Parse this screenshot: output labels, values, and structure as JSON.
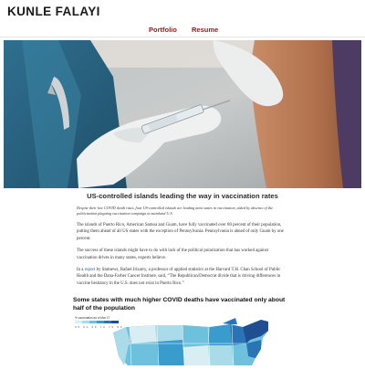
{
  "site": {
    "title": "KUNLE FALAYI",
    "nav": [
      "Portfolio",
      "Resume"
    ]
  },
  "article": {
    "headline": "US-controlled islands leading the way in vaccination rates",
    "dek": "Despite their low COVID death rates, four US-controlled islands are leading most states in vaccination, aided by absence of the politicization plaguing vaccination campaign in mainland U.S.",
    "para1": "The islands of Puerto Rico, American Samoa and Guam, have fully vaccinated over 80 percent of their population, putting them ahead of all US states with the exception of Pennsylvania. Pennsylvania is ahead of only Guam by one percent.",
    "para2": "The success of these islands might have to do with lack of the political polarization that has worked against vaccination drives in many states, experts believe.",
    "para3_before": "In a ",
    "para3_link": "report",
    "para3_after": " by Statnews, Rafael Irizarry, a professor of applied statistics at the Harvard T.H. Chan School of Public Health and the Dana-Farber Cancer Institute, said, “The Republican/Democrat divide that is driving differences in vaccine hesitancy in the U.S. does not exist in Puerto Rico.”",
    "section_heading": "Some states with much higher COVID deaths have vaccinated only about half of the population"
  },
  "map_legend": {
    "title": "% vaccination as of Mar 17",
    "ticks": "55 60 65 70 75 80",
    "colors": [
      "#d8eef3",
      "#a9dbe8",
      "#6ec1dd",
      "#3a9ccc",
      "#2a73b5",
      "#1f4e93"
    ]
  },
  "colors": {
    "nav_link": "#8b1a1a",
    "link": "#2462a8"
  }
}
